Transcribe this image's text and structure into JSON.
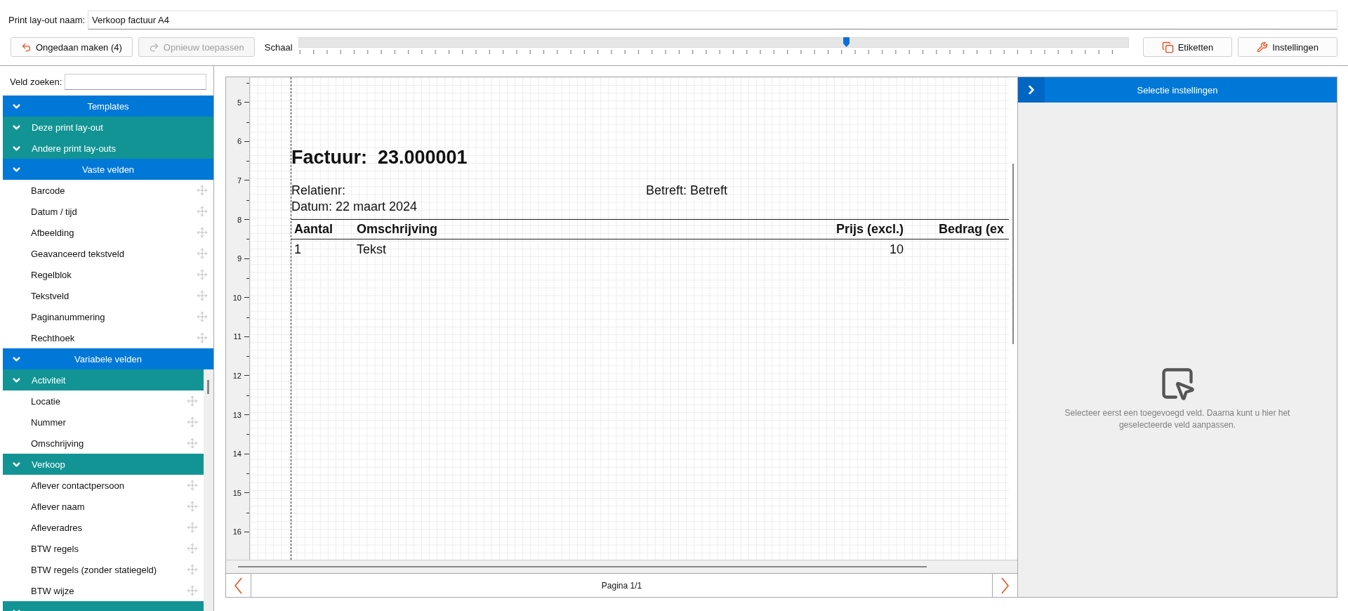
{
  "layout_name": {
    "label": "Print lay-out naam:",
    "value": "Verkoop factuur A4"
  },
  "toolbar": {
    "buttons": [
      {
        "kind": "undo",
        "label": "Ongedaan maken (4)",
        "disabled": false
      },
      {
        "kind": "redo",
        "label": "Opnieuw toepassen",
        "disabled": true
      }
    ],
    "scale": {
      "label": "Schaal",
      "level": 0.66
    },
    "right_buttons": [
      {
        "kind": "labels",
        "label": "Etiketten"
      },
      {
        "kind": "settings",
        "label": "Instellingen"
      }
    ]
  },
  "sidebar": {
    "search": {
      "label": "Veld zoeken:"
    },
    "rows": [
      {
        "kind": "main",
        "label": "Templates"
      },
      {
        "kind": "group",
        "label": "Deze print lay-out"
      },
      {
        "kind": "group",
        "label": "Andere print lay-outs"
      },
      {
        "kind": "main",
        "label": "Vaste velden"
      },
      {
        "kind": "field",
        "label": "Barcode"
      },
      {
        "kind": "field",
        "label": "Datum / tijd"
      },
      {
        "kind": "field",
        "label": "Afbeelding"
      },
      {
        "kind": "field",
        "label": "Geavanceerd tekstveld"
      },
      {
        "kind": "field",
        "label": "Regelblok"
      },
      {
        "kind": "field",
        "label": "Tekstveld"
      },
      {
        "kind": "field",
        "label": "Paginanummering"
      },
      {
        "kind": "field",
        "label": "Rechthoek"
      },
      {
        "kind": "main",
        "label": "Variabele velden"
      },
      {
        "kind": "group",
        "label": "Activiteit"
      },
      {
        "kind": "field",
        "label": "Locatie"
      },
      {
        "kind": "field",
        "label": "Nummer"
      },
      {
        "kind": "field",
        "label": "Omschrijving"
      },
      {
        "kind": "group",
        "label": "Verkoop"
      },
      {
        "kind": "field",
        "label": "Aflever contactpersoon"
      },
      {
        "kind": "field",
        "label": "Aflever naam"
      },
      {
        "kind": "field",
        "label": "Afleveradres"
      },
      {
        "kind": "field",
        "label": "BTW regels"
      },
      {
        "kind": "field",
        "label": "BTW regels (zonder statiegeld)"
      },
      {
        "kind": "field",
        "label": "BTW wijze"
      },
      {
        "kind": "group"
      }
    ]
  },
  "canvas": {
    "ruler": [
      "5",
      "6",
      "7",
      "8",
      "9",
      "10",
      "11",
      "12",
      "13",
      "14",
      "15",
      "16"
    ],
    "document": {
      "title": "Factuur:  23.000001",
      "relation": "Relatienr:",
      "subject": "Betreft: Betreft",
      "date": "Datum: 22 maart 2024",
      "table": {
        "columns": [
          "Aantal",
          "Omschrijving",
          "Prijs (excl.)",
          "Bedrag (ex"
        ],
        "rows": [
          [
            "1",
            "Tekst",
            "10"
          ]
        ]
      }
    }
  },
  "pager": {
    "label": "Pagina 1/1"
  },
  "right_panel": {
    "title": "Selectie instellingen",
    "message": "Selecteer eerst een toegevoegd veld. Daarna kunt u hier het geselecteerde veld aanpassen."
  }
}
